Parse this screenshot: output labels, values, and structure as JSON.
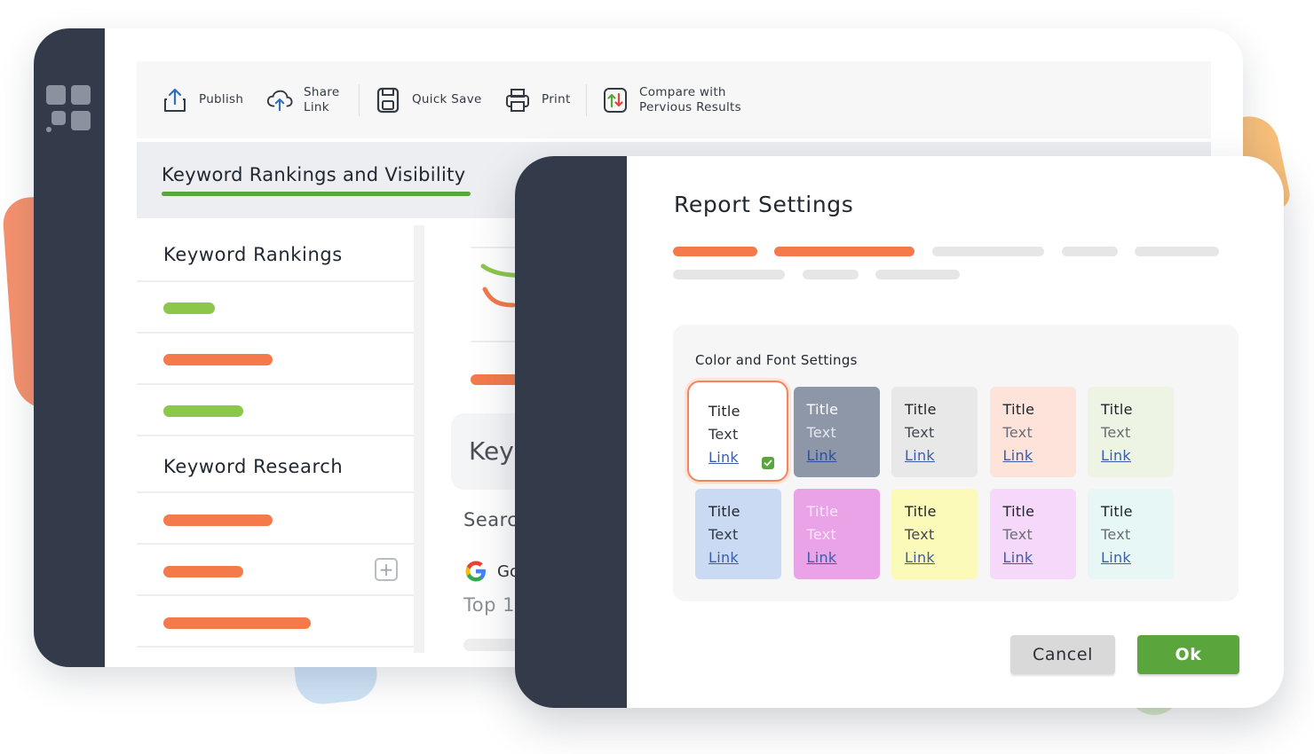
{
  "colors": {
    "rail": "#333a4a",
    "accent_orange": "#f47a4c",
    "accent_green": "#8cc74b",
    "ok_green": "#5aa63c",
    "placeholder_gray": "#e6e6e6"
  },
  "toolbar": {
    "items": [
      {
        "icon": "upload-icon",
        "label": "Publish"
      },
      {
        "icon": "cloud-upload-icon",
        "label": "Share\nLink"
      },
      {
        "icon": "save-icon",
        "label": "Quick Save"
      },
      {
        "icon": "print-icon",
        "label": "Print"
      },
      {
        "icon": "compare-icon",
        "label": "Compare with\nPervious Results"
      }
    ]
  },
  "tab": {
    "title": "Keyword Rankings and Visibility"
  },
  "sidebar": {
    "section1": {
      "heading": "Keyword Rankings"
    },
    "section2": {
      "heading": "Keyword Research"
    }
  },
  "middle": {
    "card_title": "Key",
    "search_label": "Searc",
    "google_text": "Go",
    "top_label": "Top 1"
  },
  "dialog": {
    "title": "Report Settings",
    "color_font": {
      "label": "Color and Font Settings",
      "swatches": [
        {
          "title": "Title",
          "text": "Text",
          "link": "Link",
          "bg": "#ffffff",
          "title_color": "#1f2329",
          "text_color": "#333a44",
          "link_color": "#3a5dab",
          "selected": true
        },
        {
          "title": "Title",
          "text": "Text",
          "link": "Link",
          "bg": "#8e97a7",
          "title_color": "#ffffff",
          "text_color": "#e4e8ee",
          "link_color": "#2f4f9c",
          "selected": false
        },
        {
          "title": "Title",
          "text": "Text",
          "link": "Link",
          "bg": "#e8e8e8",
          "title_color": "#1f2329",
          "text_color": "#44484f",
          "link_color": "#3a5dab",
          "selected": false
        },
        {
          "title": "Title",
          "text": "Text",
          "link": "Link",
          "bg": "#fde3da",
          "title_color": "#1f2329",
          "text_color": "#6a6e75",
          "link_color": "#3a5dab",
          "selected": false
        },
        {
          "title": "Title",
          "text": "Text",
          "link": "Link",
          "bg": "#edf4e4",
          "title_color": "#1f2329",
          "text_color": "#6a6e75",
          "link_color": "#3a5dab",
          "selected": false
        },
        {
          "title": "Title",
          "text": "Text",
          "link": "Link",
          "bg": "#c9daf2",
          "title_color": "#1f2329",
          "text_color": "#333a44",
          "link_color": "#3a5dab",
          "selected": false
        },
        {
          "title": "Title",
          "text": "Text",
          "link": "Link",
          "bg": "#e9a3e6",
          "title_color": "#fbe8fa",
          "text_color": "#fbe8fa",
          "link_color": "#3a5dab",
          "selected": false
        },
        {
          "title": "Title",
          "text": "Text",
          "link": "Link",
          "bg": "#fbfab8",
          "title_color": "#1f2329",
          "text_color": "#44484f",
          "link_color": "#3a5dab",
          "selected": false
        },
        {
          "title": "Title",
          "text": "Text",
          "link": "Link",
          "bg": "#f6d8fa",
          "title_color": "#1f2329",
          "text_color": "#6a6e75",
          "link_color": "#3a5dab",
          "selected": false
        },
        {
          "title": "Title",
          "text": "Text",
          "link": "Link",
          "bg": "#e6f7f6",
          "title_color": "#1f2329",
          "text_color": "#6a6e75",
          "link_color": "#3a5dab",
          "selected": false
        }
      ]
    },
    "buttons": {
      "cancel": "Cancel",
      "ok": "Ok"
    }
  }
}
